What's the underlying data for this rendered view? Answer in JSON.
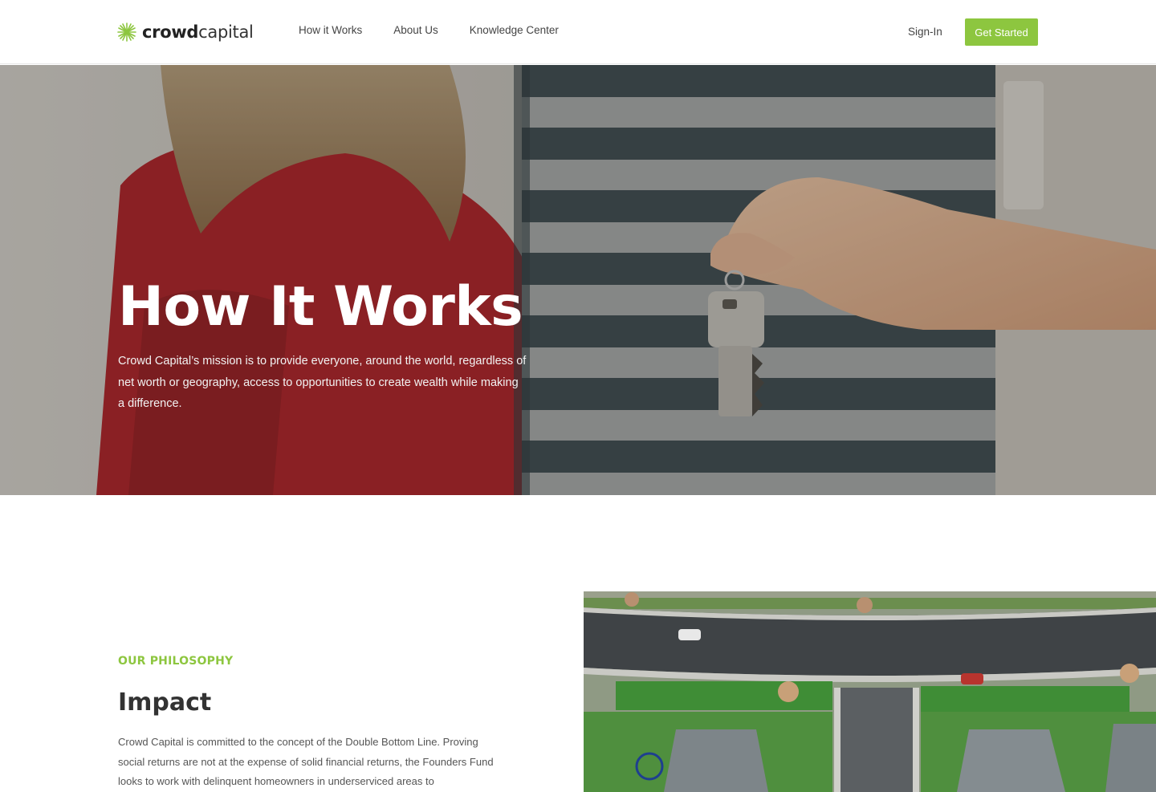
{
  "brand": {
    "name_bold": "crowd",
    "name_light": "capital",
    "accent_color": "#8dc63f",
    "icon": "starburst-logo-icon"
  },
  "nav": {
    "links": [
      {
        "label": "How it Works"
      },
      {
        "label": "About Us"
      },
      {
        "label": "Knowledge Center"
      }
    ],
    "signin_label": "Sign-In",
    "cta_label": "Get Started"
  },
  "hero": {
    "title": "How It Works",
    "text": "Crowd Capital’s mission is to provide everyone, around the world, regardless of net worth or geography, access to opportunities to create wealth while making a difference.",
    "image": "hand-holding-house-key-photo"
  },
  "philosophy": {
    "eyebrow": "OUR PHILOSOPHY",
    "title": "Impact",
    "body": "Crowd Capital is committed to the concept of the Double Bottom Line. Proving social returns are not at the expense of solid financial returns, the Founders Fund looks to work with delinquent homeowners in underserviced areas to",
    "image": "aerial-neighborhood-photo"
  }
}
